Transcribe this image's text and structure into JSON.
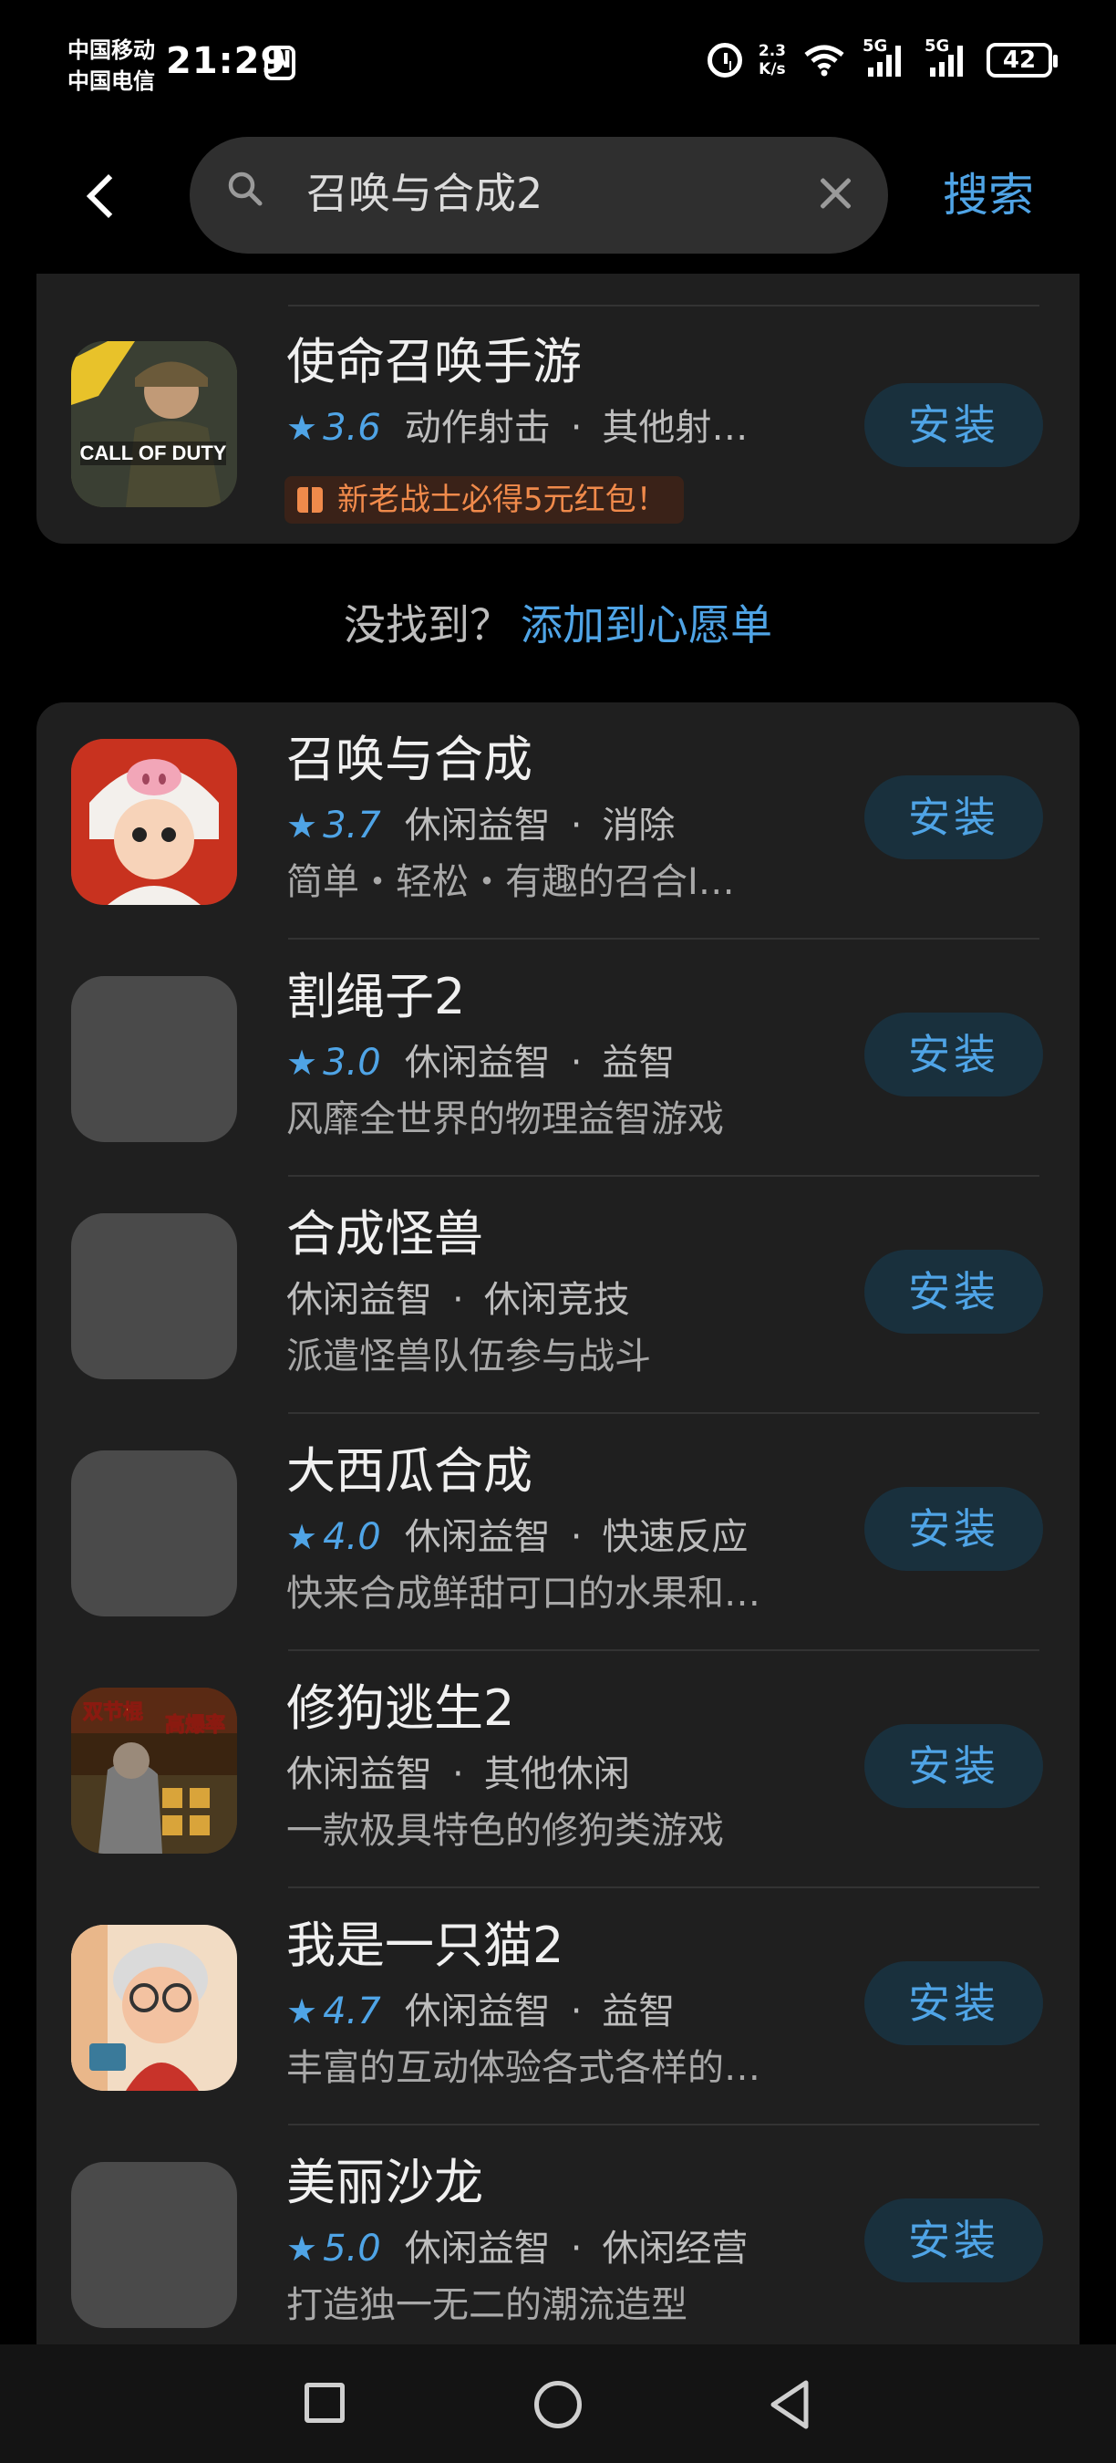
{
  "status_bar": {
    "carrier_1": "中国移动",
    "carrier_2": "中国电信",
    "time": "21:29",
    "net_speed_value": "2.3",
    "net_speed_unit": "K/s",
    "network_1": "5G",
    "network_2": "5G",
    "battery": "42"
  },
  "search": {
    "query": "召唤与合成2",
    "button_label": "搜索"
  },
  "top_result": {
    "name": "使命召唤手游",
    "rating": "3.6",
    "category": "动作射击",
    "subcategory": "其他射…",
    "promo": "新老战士必得5元红包！",
    "install_label": "安装"
  },
  "not_found": {
    "question": "没找到？",
    "link": "添加到心愿单"
  },
  "results": [
    {
      "name": "召唤与合成",
      "rating": "3.7",
      "category": "休闲益智",
      "subcategory": "消除",
      "desc": "简单・轻松・有趣的召合I…",
      "install_label": "安装"
    },
    {
      "name": "割绳子2",
      "rating": "3.0",
      "category": "休闲益智",
      "subcategory": "益智",
      "desc": "风靡全世界的物理益智游戏",
      "install_label": "安装"
    },
    {
      "name": "合成怪兽",
      "rating": "",
      "category": "休闲益智",
      "subcategory": "休闲竞技",
      "desc": "派遣怪兽队伍参与战斗",
      "install_label": "安装"
    },
    {
      "name": "大西瓜合成",
      "rating": "4.0",
      "category": "休闲益智",
      "subcategory": "快速反应",
      "desc": "快来合成鲜甜可口的水果和…",
      "install_label": "安装"
    },
    {
      "name": "修狗逃生2",
      "rating": "",
      "category": "休闲益智",
      "subcategory": "其他休闲",
      "desc": "一款极具特色的修狗类游戏",
      "install_label": "安装",
      "icon_text": "双节棍 高爆率"
    },
    {
      "name": "我是一只猫2",
      "rating": "4.7",
      "category": "休闲益智",
      "subcategory": "益智",
      "desc": "丰富的互动体验各式各样的…",
      "install_label": "安装"
    },
    {
      "name": "美丽沙龙",
      "rating": "5.0",
      "category": "休闲益智",
      "subcategory": "休闲经营",
      "desc": "打造独一无二的潮流造型",
      "install_label": "安装"
    }
  ],
  "colors": {
    "accent": "#4fa4e6",
    "card": "#1f1f1f",
    "promo_text": "#f08a4b",
    "install_bg": "#19303d"
  }
}
